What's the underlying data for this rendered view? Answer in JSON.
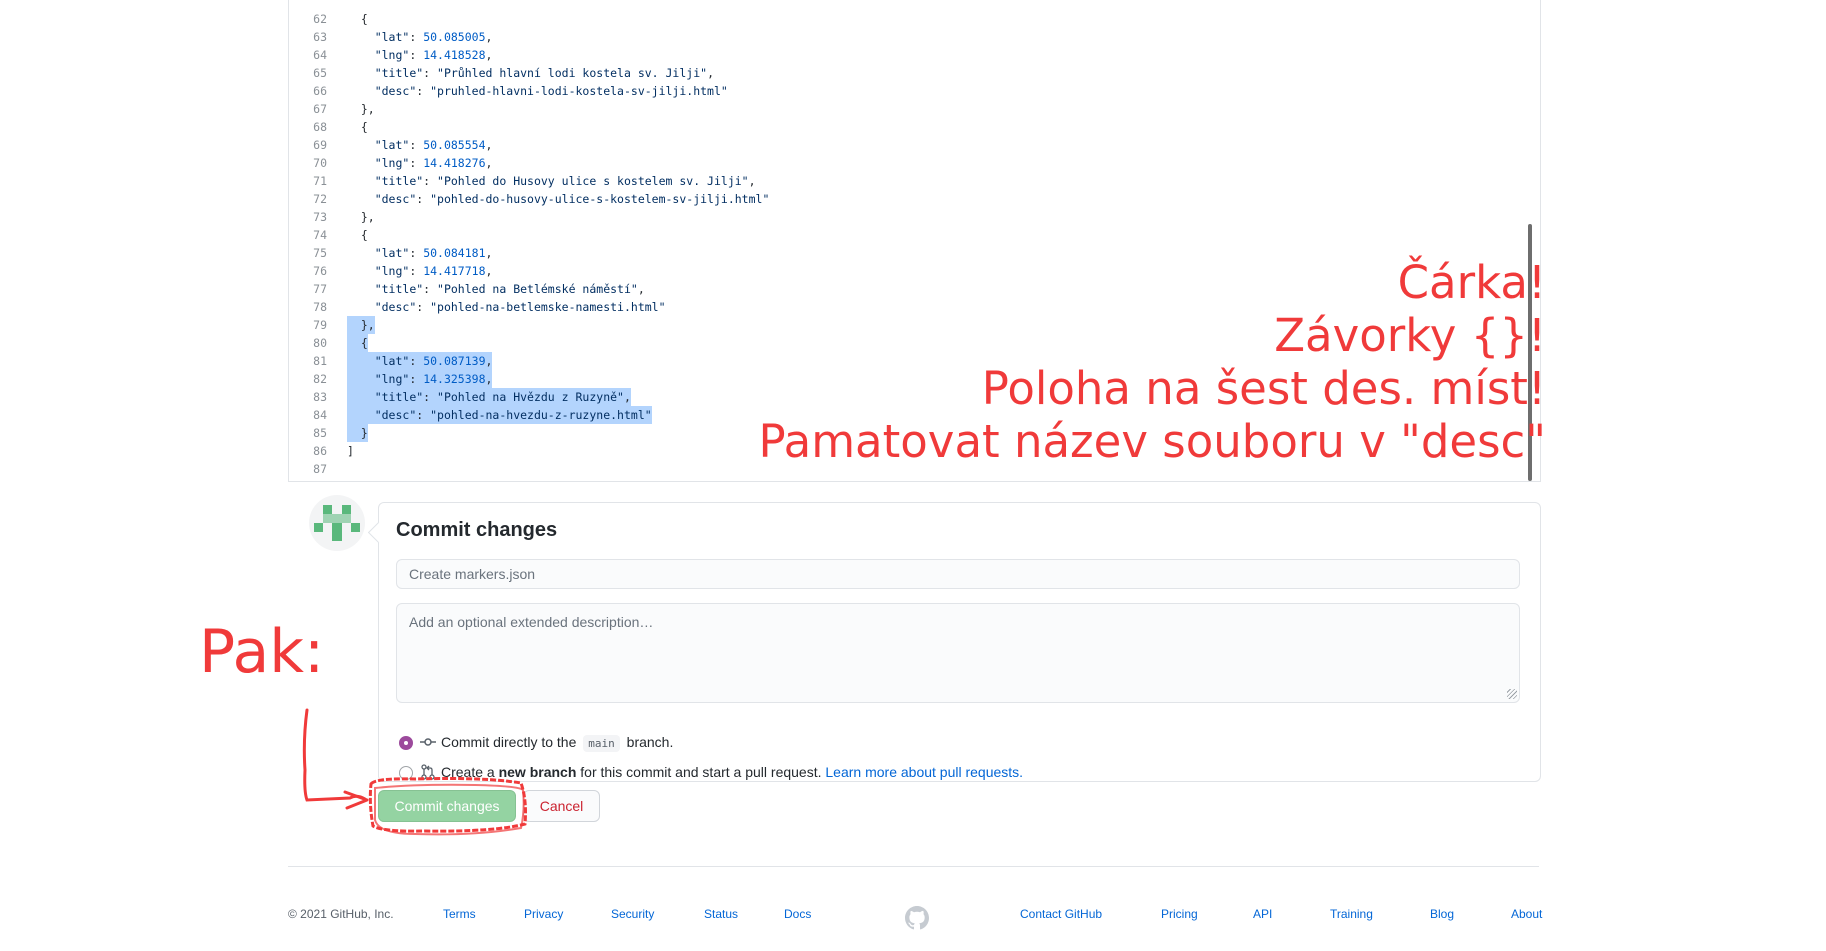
{
  "editor": {
    "lines": [
      {
        "n": "62",
        "segs": [
          [
            "p",
            "  {"
          ]
        ]
      },
      {
        "n": "63",
        "segs": [
          [
            "p",
            "    "
          ],
          [
            "s",
            "\"lat\""
          ],
          [
            "p",
            ": "
          ],
          [
            "n",
            "50.085005"
          ],
          [
            "p",
            ","
          ]
        ]
      },
      {
        "n": "64",
        "segs": [
          [
            "p",
            "    "
          ],
          [
            "s",
            "\"lng\""
          ],
          [
            "p",
            ": "
          ],
          [
            "n",
            "14.418528"
          ],
          [
            "p",
            ","
          ]
        ]
      },
      {
        "n": "65",
        "segs": [
          [
            "p",
            "    "
          ],
          [
            "s",
            "\"title\""
          ],
          [
            "p",
            ": "
          ],
          [
            "s",
            "\"Průhled hlavní lodi kostela sv. Jilji\""
          ],
          [
            "p",
            ","
          ]
        ]
      },
      {
        "n": "66",
        "segs": [
          [
            "p",
            "    "
          ],
          [
            "s",
            "\"desc\""
          ],
          [
            "p",
            ": "
          ],
          [
            "s",
            "\"pruhled-hlavni-lodi-kostela-sv-jilji.html\""
          ]
        ]
      },
      {
        "n": "67",
        "segs": [
          [
            "p",
            "  },"
          ]
        ]
      },
      {
        "n": "68",
        "segs": [
          [
            "p",
            "  {"
          ]
        ]
      },
      {
        "n": "69",
        "segs": [
          [
            "p",
            "    "
          ],
          [
            "s",
            "\"lat\""
          ],
          [
            "p",
            ": "
          ],
          [
            "n",
            "50.085554"
          ],
          [
            "p",
            ","
          ]
        ]
      },
      {
        "n": "70",
        "segs": [
          [
            "p",
            "    "
          ],
          [
            "s",
            "\"lng\""
          ],
          [
            "p",
            ": "
          ],
          [
            "n",
            "14.418276"
          ],
          [
            "p",
            ","
          ]
        ]
      },
      {
        "n": "71",
        "segs": [
          [
            "p",
            "    "
          ],
          [
            "s",
            "\"title\""
          ],
          [
            "p",
            ": "
          ],
          [
            "s",
            "\"Pohled do Husovy ulice s kostelem sv. Jilji\""
          ],
          [
            "p",
            ","
          ]
        ]
      },
      {
        "n": "72",
        "segs": [
          [
            "p",
            "    "
          ],
          [
            "s",
            "\"desc\""
          ],
          [
            "p",
            ": "
          ],
          [
            "s",
            "\"pohled-do-husovy-ulice-s-kostelem-sv-jilji.html\""
          ]
        ]
      },
      {
        "n": "73",
        "segs": [
          [
            "p",
            "  },"
          ]
        ]
      },
      {
        "n": "74",
        "segs": [
          [
            "p",
            "  {"
          ]
        ]
      },
      {
        "n": "75",
        "segs": [
          [
            "p",
            "    "
          ],
          [
            "s",
            "\"lat\""
          ],
          [
            "p",
            ": "
          ],
          [
            "n",
            "50.084181"
          ],
          [
            "p",
            ","
          ]
        ]
      },
      {
        "n": "76",
        "segs": [
          [
            "p",
            "    "
          ],
          [
            "s",
            "\"lng\""
          ],
          [
            "p",
            ": "
          ],
          [
            "n",
            "14.417718"
          ],
          [
            "p",
            ","
          ]
        ]
      },
      {
        "n": "77",
        "segs": [
          [
            "p",
            "    "
          ],
          [
            "s",
            "\"title\""
          ],
          [
            "p",
            ": "
          ],
          [
            "s",
            "\"Pohled na Betlémské náměstí\""
          ],
          [
            "p",
            ","
          ]
        ]
      },
      {
        "n": "78",
        "segs": [
          [
            "p",
            "    "
          ],
          [
            "s",
            "\"desc\""
          ],
          [
            "p",
            ": "
          ],
          [
            "s",
            "\"pohled-na-betlemske-namesti.html\""
          ]
        ]
      },
      {
        "n": "79",
        "segs": [
          [
            "p",
            "  },"
          ]
        ]
      },
      {
        "n": "80",
        "segs": [
          [
            "p",
            "  {"
          ]
        ]
      },
      {
        "n": "81",
        "segs": [
          [
            "p",
            "    "
          ],
          [
            "s",
            "\"lat\""
          ],
          [
            "p",
            ": "
          ],
          [
            "n",
            "50.087139"
          ],
          [
            "p",
            ","
          ]
        ]
      },
      {
        "n": "82",
        "segs": [
          [
            "p",
            "    "
          ],
          [
            "s",
            "\"lng\""
          ],
          [
            "p",
            ": "
          ],
          [
            "n",
            "14.325398"
          ],
          [
            "p",
            ","
          ]
        ]
      },
      {
        "n": "83",
        "segs": [
          [
            "p",
            "    "
          ],
          [
            "s",
            "\"title\""
          ],
          [
            "p",
            ": "
          ],
          [
            "s",
            "\"Pohled na Hvězdu z Ruzyně\""
          ],
          [
            "p",
            ","
          ]
        ]
      },
      {
        "n": "84",
        "segs": [
          [
            "p",
            "    "
          ],
          [
            "s",
            "\"desc\""
          ],
          [
            "p",
            ": "
          ],
          [
            "s",
            "\"pohled-na-hvezdu-z-ruzyne.html\""
          ]
        ]
      },
      {
        "n": "85",
        "segs": [
          [
            "p",
            "  }"
          ]
        ]
      },
      {
        "n": "86",
        "segs": [
          [
            "p",
            "]"
          ]
        ]
      },
      {
        "n": "87",
        "segs": []
      }
    ],
    "highlighted": [
      "79",
      "80",
      "81",
      "82",
      "83",
      "84",
      "85"
    ]
  },
  "annotations": {
    "right": [
      "Čárka!",
      "Závorky {}!",
      "Poloha na šest des. míst!",
      "Pamatovat název souboru v \"desc\""
    ],
    "pak": "Pak:",
    "color": "#f03a3a"
  },
  "commit": {
    "heading": "Commit changes",
    "summary_placeholder": "Create markers.json",
    "description_placeholder": "Add an optional extended description…",
    "option_direct": {
      "before": "Commit directly to the",
      "branch": "main",
      "after": "branch."
    },
    "option_new": {
      "before": "Create a",
      "bold": "new branch",
      "after": "for this commit and start a pull request.",
      "link": "Learn more about pull requests."
    },
    "commit_button": "Commit changes",
    "cancel_button": "Cancel"
  },
  "footer": {
    "copyright": "© 2021 GitHub, Inc.",
    "left_links": [
      "Terms",
      "Privacy",
      "Security",
      "Status",
      "Docs"
    ],
    "right_links": [
      "Contact GitHub",
      "Pricing",
      "API",
      "Training",
      "Blog",
      "About"
    ]
  }
}
